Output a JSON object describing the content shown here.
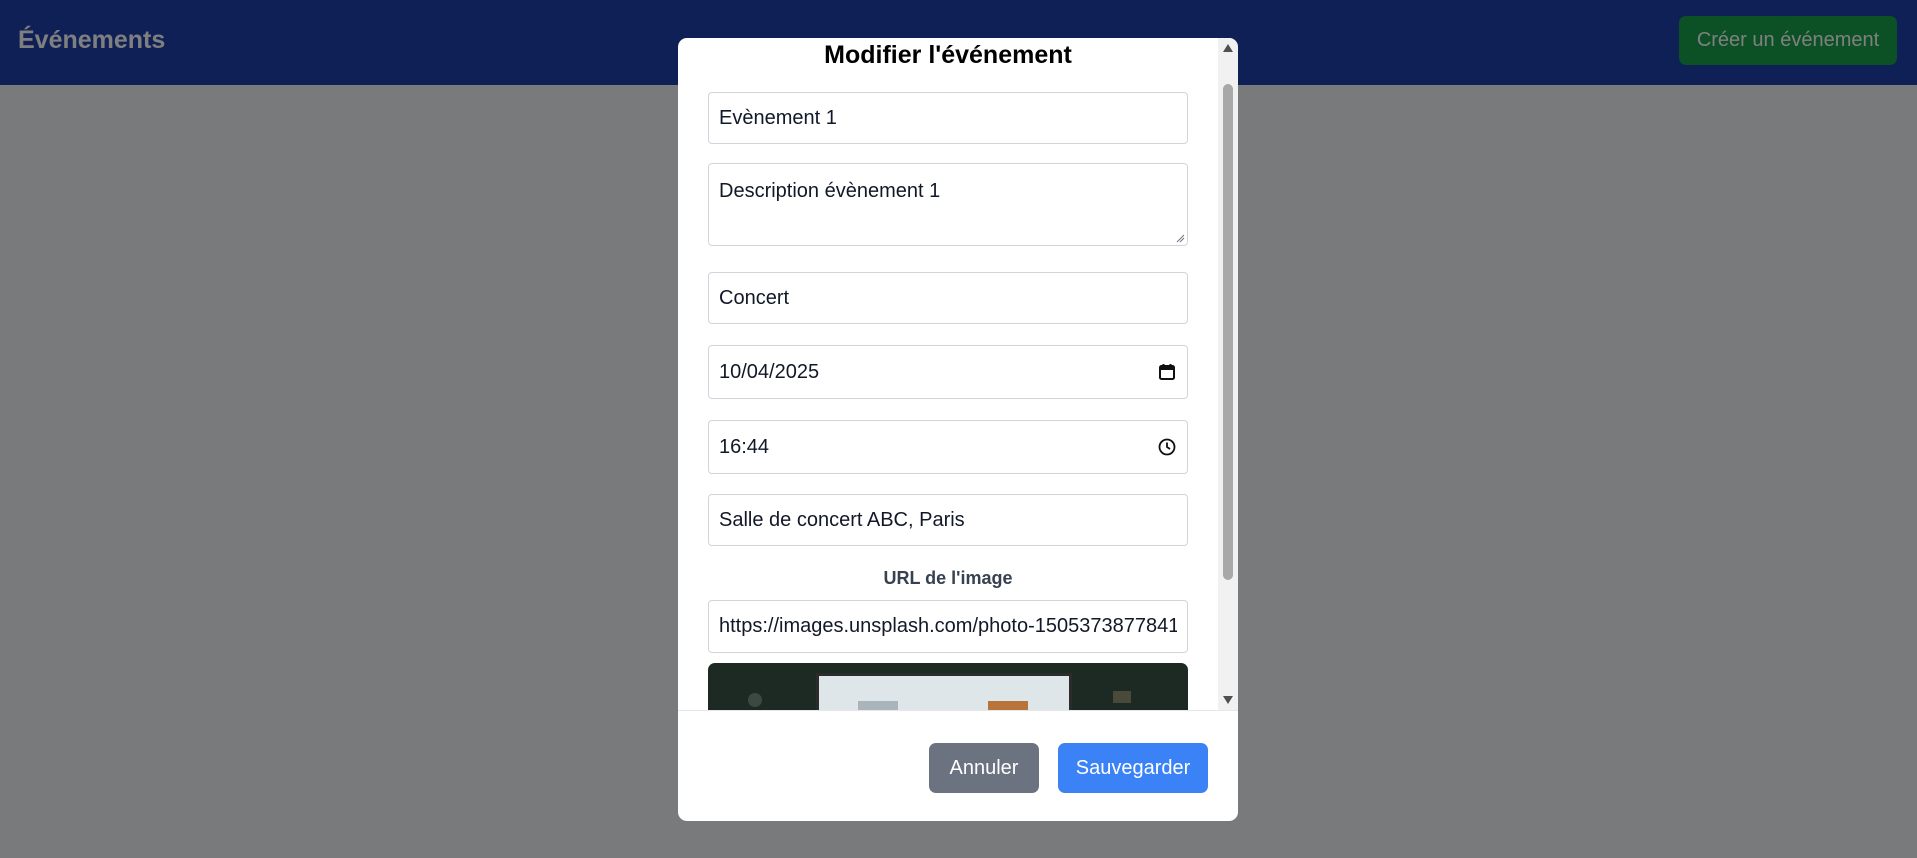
{
  "header": {
    "title": "Événements",
    "create_button": "Créer un événement"
  },
  "modal": {
    "title": "Modifier l'événement",
    "fields": {
      "name": "Evènement 1",
      "description": "Description évènement 1",
      "category": "Concert",
      "date": "10/04/2025",
      "time": "16:44",
      "location": "Salle de concert ABC, Paris",
      "image_label": "URL de l'image",
      "image_url": "https://images.unsplash.com/photo-1505373877841"
    },
    "buttons": {
      "cancel": "Annuler",
      "save": "Sauvegarder"
    }
  },
  "icons": {
    "date": "calendar-icon",
    "time": "clock-icon",
    "scroll_up": "scroll-up-arrow-icon",
    "scroll_down": "scroll-down-arrow-icon"
  },
  "colors": {
    "header_bg": "#1e40af",
    "create_button_bg": "#16a34a",
    "cancel_button_bg": "#6b7280",
    "save_button_bg": "#3b82f6"
  }
}
